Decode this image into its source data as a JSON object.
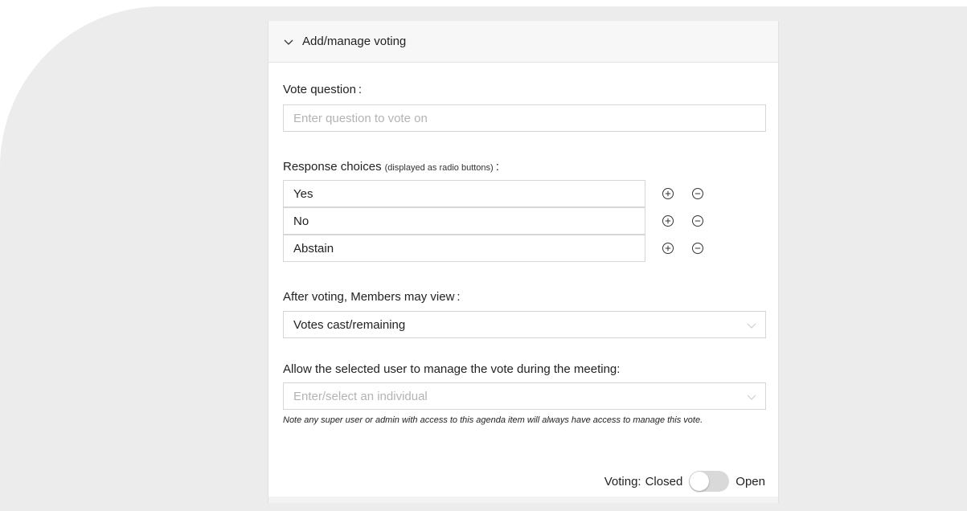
{
  "section": {
    "header_title": "Add/manage voting"
  },
  "vote_question": {
    "label": "Vote question",
    "colon": ":",
    "placeholder": "Enter question to vote on"
  },
  "response_choices": {
    "label": "Response choices",
    "hint": "(displayed as radio buttons)",
    "colon": ":",
    "items": [
      {
        "value": "Yes"
      },
      {
        "value": "No"
      },
      {
        "value": "Abstain"
      }
    ]
  },
  "after_voting": {
    "label": "After voting, Members may view",
    "colon": ":",
    "selected": "Votes cast/remaining"
  },
  "manager": {
    "label": "Allow the selected user to manage the vote during the meeting:",
    "placeholder": "Enter/select an individual",
    "note": "Note any super user or admin with access to this agenda item will always have access to manage this vote."
  },
  "voting_toggle": {
    "prefix": "Voting:",
    "off_label": "Closed",
    "on_label": "Open",
    "state": "Closed"
  },
  "icons": {
    "collapse": "chevron-down-icon",
    "add": "plus-circle-icon",
    "remove": "minus-circle-icon",
    "dropdown": "chevron-down-icon"
  }
}
